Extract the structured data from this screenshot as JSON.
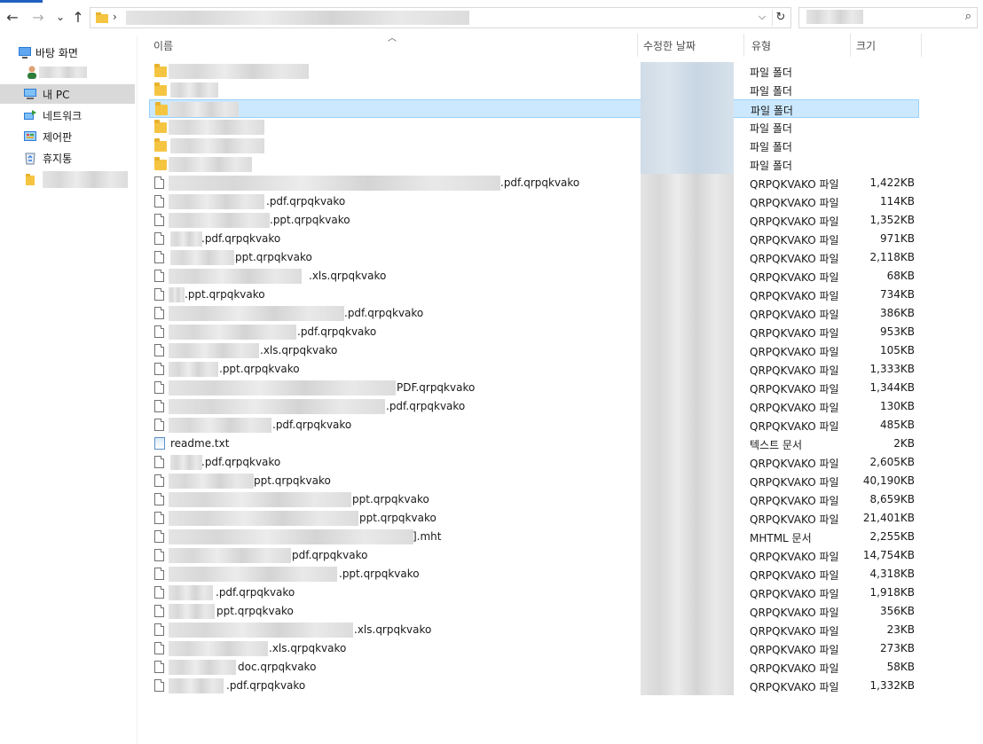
{
  "address_bar": {
    "separator": "›",
    "dropdown": "⌵",
    "refresh": "↻"
  },
  "search": {
    "icon": "⌕"
  },
  "nav": {
    "back": "←",
    "forward": "→",
    "recent": "⌄",
    "up": "↑"
  },
  "sidebar": {
    "items": [
      {
        "label": "바탕 화면",
        "icon": "desktop-icon"
      },
      {
        "label": "",
        "icon": "user-icon"
      },
      {
        "label": "내 PC",
        "icon": "pc-icon"
      },
      {
        "label": "네트워크",
        "icon": "network-icon"
      },
      {
        "label": "제어판",
        "icon": "control-panel-icon"
      },
      {
        "label": "휴지통",
        "icon": "recycle-bin-icon"
      },
      {
        "label": "",
        "icon": "folder-icon"
      }
    ]
  },
  "columns": {
    "name": "이름",
    "date": "수정한 날짜",
    "type": "유형",
    "size": "크기"
  },
  "files": [
    {
      "kind": "folder",
      "name": "",
      "type": "파일 폴더",
      "size": ""
    },
    {
      "kind": "folder",
      "name": "",
      "type": "파일 폴더",
      "size": ""
    },
    {
      "kind": "folder",
      "name": "",
      "type": "파일 폴더",
      "size": ""
    },
    {
      "kind": "folder",
      "name": "",
      "type": "파일 폴더",
      "size": ""
    },
    {
      "kind": "folder",
      "name": "",
      "type": "파일 폴더",
      "size": ""
    },
    {
      "kind": "folder",
      "name": "",
      "type": "파일 폴더",
      "size": ""
    },
    {
      "kind": "file",
      "name": ".pdf.qrpqkvako",
      "type": "QRPQKVAKO 파일",
      "size": "1,422KB"
    },
    {
      "kind": "file",
      "name": ".pdf.qrpqkvako",
      "type": "QRPQKVAKO 파일",
      "size": "114KB"
    },
    {
      "kind": "file",
      "name": ".ppt.qrpqkvako",
      "type": "QRPQKVAKO 파일",
      "size": "1,352KB"
    },
    {
      "kind": "file",
      "name": ".pdf.qrpqkvako",
      "type": "QRPQKVAKO 파일",
      "size": "971KB"
    },
    {
      "kind": "file",
      "name": "ppt.qrpqkvako",
      "type": "QRPQKVAKO 파일",
      "size": "2,118KB"
    },
    {
      "kind": "file",
      "name": ".xls.qrpqkvako",
      "type": "QRPQKVAKO 파일",
      "size": "68KB"
    },
    {
      "kind": "file",
      "name": ".ppt.qrpqkvako",
      "type": "QRPQKVAKO 파일",
      "size": "734KB"
    },
    {
      "kind": "file",
      "name": ".pdf.qrpqkvako",
      "type": "QRPQKVAKO 파일",
      "size": "386KB"
    },
    {
      "kind": "file",
      "name": ".pdf.qrpqkvako",
      "type": "QRPQKVAKO 파일",
      "size": "953KB"
    },
    {
      "kind": "file",
      "name": ".xls.qrpqkvako",
      "type": "QRPQKVAKO 파일",
      "size": "105KB"
    },
    {
      "kind": "file",
      "name": ".ppt.qrpqkvako",
      "type": "QRPQKVAKO 파일",
      "size": "1,333KB"
    },
    {
      "kind": "file",
      "name": "PDF.qrpqkvako",
      "type": "QRPQKVAKO 파일",
      "size": "1,344KB"
    },
    {
      "kind": "file",
      "name": ".pdf.qrpqkvako",
      "type": "QRPQKVAKO 파일",
      "size": "130KB"
    },
    {
      "kind": "file",
      "name": ".pdf.qrpqkvako",
      "type": "QRPQKVAKO 파일",
      "size": "485KB"
    },
    {
      "kind": "txt",
      "name": "readme.txt",
      "type": "텍스트 문서",
      "size": "2KB"
    },
    {
      "kind": "file",
      "name": ".pdf.qrpqkvako",
      "type": "QRPQKVAKO 파일",
      "size": "2,605KB"
    },
    {
      "kind": "file",
      "name": "ppt.qrpqkvako",
      "type": "QRPQKVAKO 파일",
      "size": "40,190KB"
    },
    {
      "kind": "file",
      "name": "ppt.qrpqkvako",
      "type": "QRPQKVAKO 파일",
      "size": "8,659KB"
    },
    {
      "kind": "file",
      "name": "ppt.qrpqkvako",
      "type": "QRPQKVAKO 파일",
      "size": "21,401KB"
    },
    {
      "kind": "file",
      "name": "].mht",
      "type": "MHTML 문서",
      "size": "2,255KB"
    },
    {
      "kind": "file",
      "name": "pdf.qrpqkvako",
      "type": "QRPQKVAKO 파일",
      "size": "14,754KB"
    },
    {
      "kind": "file",
      "name": ".ppt.qrpqkvako",
      "type": "QRPQKVAKO 파일",
      "size": "4,318KB"
    },
    {
      "kind": "file",
      "name": ".pdf.qrpqkvako",
      "type": "QRPQKVAKO 파일",
      "size": "1,918KB"
    },
    {
      "kind": "file",
      "name": "ppt.qrpqkvako",
      "type": "QRPQKVAKO 파일",
      "size": "356KB"
    },
    {
      "kind": "file",
      "name": ".xls.qrpqkvako",
      "type": "QRPQKVAKO 파일",
      "size": "23KB"
    },
    {
      "kind": "file",
      "name": ".xls.qrpqkvako",
      "type": "QRPQKVAKO 파일",
      "size": "273KB"
    },
    {
      "kind": "file",
      "name": "doc.qrpqkvako",
      "type": "QRPQKVAKO 파일",
      "size": "58KB"
    },
    {
      "kind": "file",
      "name": ".pdf.qrpqkvako",
      "type": "QRPQKVAKO 파일",
      "size": "1,332KB"
    }
  ]
}
